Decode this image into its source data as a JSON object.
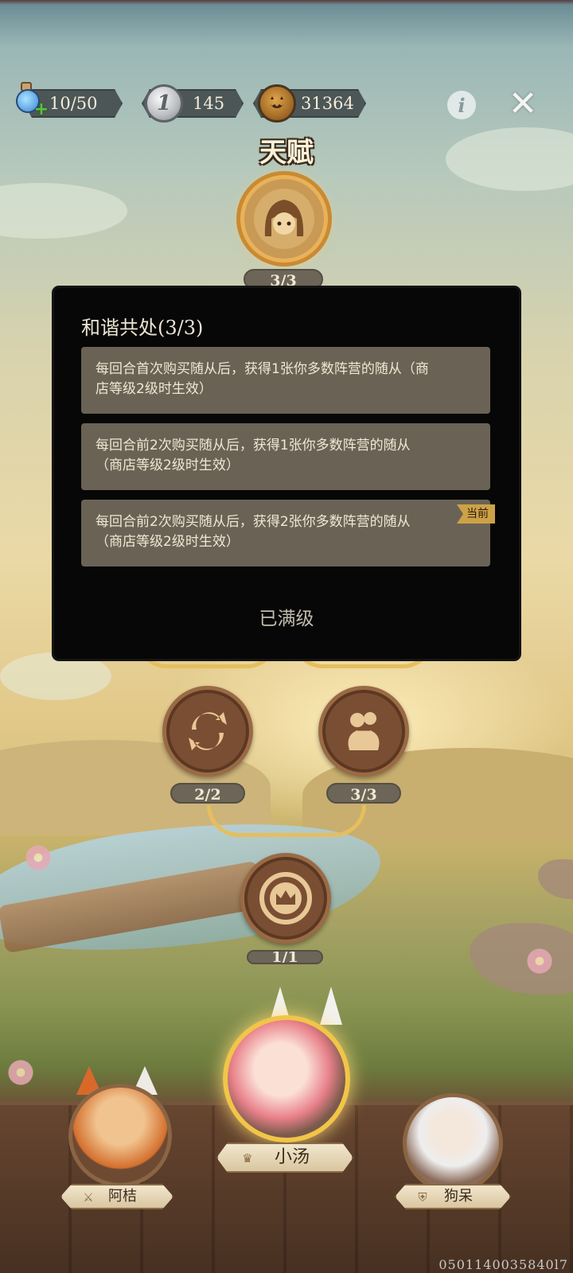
{
  "resources": {
    "energy": "10/50",
    "coins": "145",
    "coin_symbol": "1",
    "pumpkins": "31364"
  },
  "icons": {
    "info": "i",
    "close": "✕"
  },
  "page_title": "天赋",
  "talent_nodes": {
    "top": {
      "icon": "girl-portrait-icon",
      "count": "3/3"
    },
    "middle_left": {
      "icon": "refresh-icon",
      "count": "2/2"
    },
    "middle_right": {
      "icon": "money-bag-icon",
      "count": "3/3"
    },
    "bottom": {
      "icon": "crown-icon",
      "count": "1/1"
    }
  },
  "popup": {
    "title": "和谐共处(3/3)",
    "tiers": [
      "每回合首次购买随从后，获得1张你多数阵营的随从（商店等级2级时生效）",
      "每回合前2次购买随从后，获得1张你多数阵营的随从（商店等级2级时生效）",
      "每回合前2次购买随从后，获得2张你多数阵营的随从（商店等级2级时生效）"
    ],
    "current_tag": "当前",
    "max_level": "已满级"
  },
  "characters": {
    "left": "阿桔",
    "center": "小汤",
    "right": "狗呆"
  },
  "build_id": "0501140035840l7",
  "colors": {
    "popup_bg": "#070707",
    "tier_bg": "#6a6355",
    "gold_accent": "#e6be5d",
    "node_brown": "#7a4e33"
  }
}
